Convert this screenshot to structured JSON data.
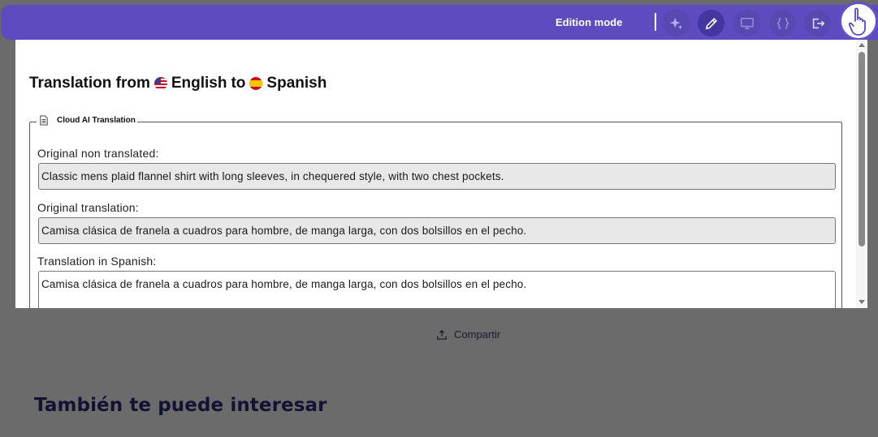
{
  "toolbar": {
    "mode_label": "Edition mode",
    "buttons": [
      {
        "icon": "sparkle-icon",
        "active": false
      },
      {
        "icon": "pencil-icon",
        "active": true
      },
      {
        "icon": "monitor-icon",
        "active": false
      },
      {
        "icon": "code-braces-icon",
        "active": false
      },
      {
        "icon": "logout-icon",
        "active": false
      }
    ],
    "accent_color": "#5e4bbf"
  },
  "panel": {
    "title_prefix": "Translation from",
    "source_language": "English",
    "title_connector": "to",
    "target_language": "Spanish",
    "source_flag": "us-flag-icon",
    "target_flag": "spain-flag-icon",
    "section_legend": "Cloud AI Translation",
    "fields": {
      "original_label": "Original non translated:",
      "original_value": "Classic mens plaid flannel shirt with long sleeves, in chequered style, with two chest pockets.",
      "original_translation_label": "Original translation:",
      "original_translation_value": "Camisa clásica de franela a cuadros para hombre, de manga larga, con dos bolsillos en el pecho.",
      "translation_label": "Translation in Spanish:",
      "translation_value": "Camisa clásica de franela a cuadros para hombre, de manga larga, con dos bolsillos en el pecho."
    }
  },
  "background": {
    "share_label": "Compartir",
    "related_heading": "También te puede interesar"
  }
}
